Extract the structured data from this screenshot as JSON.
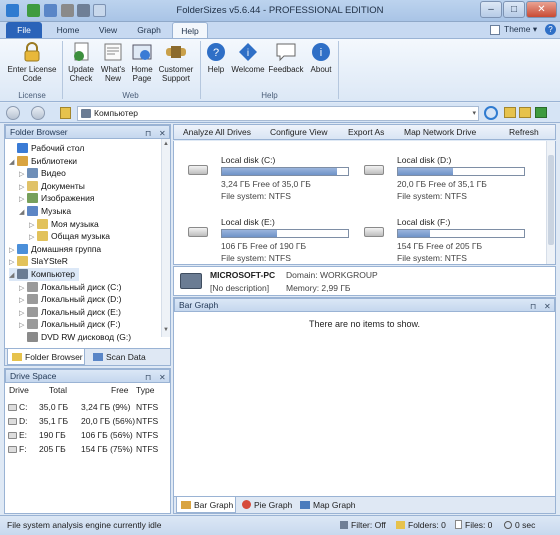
{
  "title": "FolderSizes v5.6.44 - PROFESSIONAL EDITION",
  "theme_label": "Theme",
  "tabs": [
    {
      "label": "File"
    },
    {
      "label": "Home"
    },
    {
      "label": "View"
    },
    {
      "label": "Graph"
    },
    {
      "label": "Help"
    }
  ],
  "ribbon": {
    "license_buttons": [
      {
        "label1": "Enter License",
        "label2": "Code",
        "icon": "lock-icon"
      }
    ],
    "web_buttons": [
      {
        "label1": "Update",
        "label2": "Check",
        "icon": "update-icon"
      },
      {
        "label1": "What's",
        "label2": "New",
        "icon": "news-icon"
      },
      {
        "label1": "Home",
        "label2": "Page",
        "icon": "home-page-icon"
      },
      {
        "label1": "Customer",
        "label2": "Support",
        "icon": "support-icon"
      }
    ],
    "help_buttons": [
      {
        "label1": "Help",
        "label2": "",
        "icon": "help-icon"
      },
      {
        "label1": "Welcome",
        "label2": "",
        "icon": "welcome-icon"
      },
      {
        "label1": "Feedback",
        "label2": "",
        "icon": "feedback-icon"
      },
      {
        "label1": "About",
        "label2": "",
        "icon": "about-icon"
      }
    ],
    "groups": {
      "license": "License",
      "web": "Web",
      "help": "Help"
    }
  },
  "address": {
    "value": "Компьютер"
  },
  "folder_browser": {
    "header": "Folder Browser",
    "tree": [
      {
        "label": "Рабочий стол",
        "level": 0,
        "expander": "",
        "color": "#3a7bd5"
      },
      {
        "label": "Библиотеки",
        "level": 0,
        "expander": "◢",
        "color": "#d9a441"
      },
      {
        "label": "Видео",
        "level": 1,
        "expander": "▷",
        "color": "#6f8fb8"
      },
      {
        "label": "Документы",
        "level": 1,
        "expander": "▷",
        "color": "#e0c268"
      },
      {
        "label": "Изображения",
        "level": 1,
        "expander": "▷",
        "color": "#77a05b"
      },
      {
        "label": "Музыка",
        "level": 1,
        "expander": "◢",
        "color": "#5d86c4"
      },
      {
        "label": "Моя музыка",
        "level": 2,
        "expander": "▷",
        "color": "#e2c25b"
      },
      {
        "label": "Общая музыка",
        "level": 2,
        "expander": "▷",
        "color": "#e2c25b"
      },
      {
        "label": "Домашняя группа",
        "level": 0,
        "expander": "▷",
        "color": "#4b8fd9"
      },
      {
        "label": "SlaYSteR",
        "level": 0,
        "expander": "▷",
        "color": "#e2c25b"
      },
      {
        "label": "Компьютер",
        "level": 0,
        "expander": "◢",
        "color": "#6b7c93",
        "selected": true
      },
      {
        "label": "Локальный диск (C:)",
        "level": 1,
        "expander": "▷",
        "color": "#9a9a9a"
      },
      {
        "label": "Локальный диск (D:)",
        "level": 1,
        "expander": "▷",
        "color": "#9a9a9a"
      },
      {
        "label": "Локальный диск (E:)",
        "level": 1,
        "expander": "▷",
        "color": "#9a9a9a"
      },
      {
        "label": "Локальный диск (F:)",
        "level": 1,
        "expander": "▷",
        "color": "#9a9a9a"
      },
      {
        "label": "DVD RW дисковод (G:)",
        "level": 1,
        "expander": "",
        "color": "#8a8a8a"
      }
    ],
    "tabs": [
      {
        "label": "Folder Browser"
      },
      {
        "label": "Scan Data"
      }
    ]
  },
  "drive_space": {
    "header": "Drive Space",
    "columns": [
      "Drive",
      "Total",
      "Free",
      "Type"
    ],
    "rows": [
      {
        "drive": "C:",
        "total": "35,0 ГБ",
        "free": "3,24 ГБ (9%)",
        "type": "NTFS"
      },
      {
        "drive": "D:",
        "total": "35,1 ГБ",
        "free": "20,0 ГБ (56%)",
        "type": "NTFS"
      },
      {
        "drive": "E:",
        "total": "190 ГБ",
        "free": "106 ГБ (56%)",
        "type": "NTFS"
      },
      {
        "drive": "F:",
        "total": "205 ГБ",
        "free": "154 ГБ (75%)",
        "type": "NTFS"
      }
    ]
  },
  "toolbar": {
    "analyze_all": "Analyze All Drives",
    "configure": "Configure View",
    "export": "Export As",
    "map_network": "Map Network Drive",
    "refresh": "Refresh"
  },
  "drives": [
    {
      "name": "Local disk (C:)",
      "free": "3,24 ГБ Free of 35,0 ГБ",
      "fs": "File system: NTFS",
      "used_fraction": 0.91
    },
    {
      "name": "Local disk (D:)",
      "free": "20,0 ГБ Free of 35,1 ГБ",
      "fs": "File system: NTFS",
      "used_fraction": 0.44
    },
    {
      "name": "Local disk (E:)",
      "free": "106 ГБ Free of 190 ГБ",
      "fs": "File system: NTFS",
      "used_fraction": 0.44
    },
    {
      "name": "Local disk (F:)",
      "free": "154 ГБ Free of 205 ГБ",
      "fs": "File system: NTFS",
      "used_fraction": 0.25
    }
  ],
  "pc": {
    "name": "MICROSOFT-PC",
    "description": "[No description]",
    "domain": "Domain: WORKGROUP",
    "memory": "Memory: 2,99 ГБ"
  },
  "bar_graph": {
    "header": "Bar Graph",
    "empty_text": "There are no items to show.",
    "tabs": [
      {
        "label": "Bar Graph"
      },
      {
        "label": "Pie Graph"
      },
      {
        "label": "Map Graph"
      }
    ]
  },
  "status": {
    "text": "File system analysis engine currently idle",
    "filter": "Filter: Off",
    "folders": "Folders: 0",
    "files": "Files: 0",
    "time": "0 sec"
  }
}
